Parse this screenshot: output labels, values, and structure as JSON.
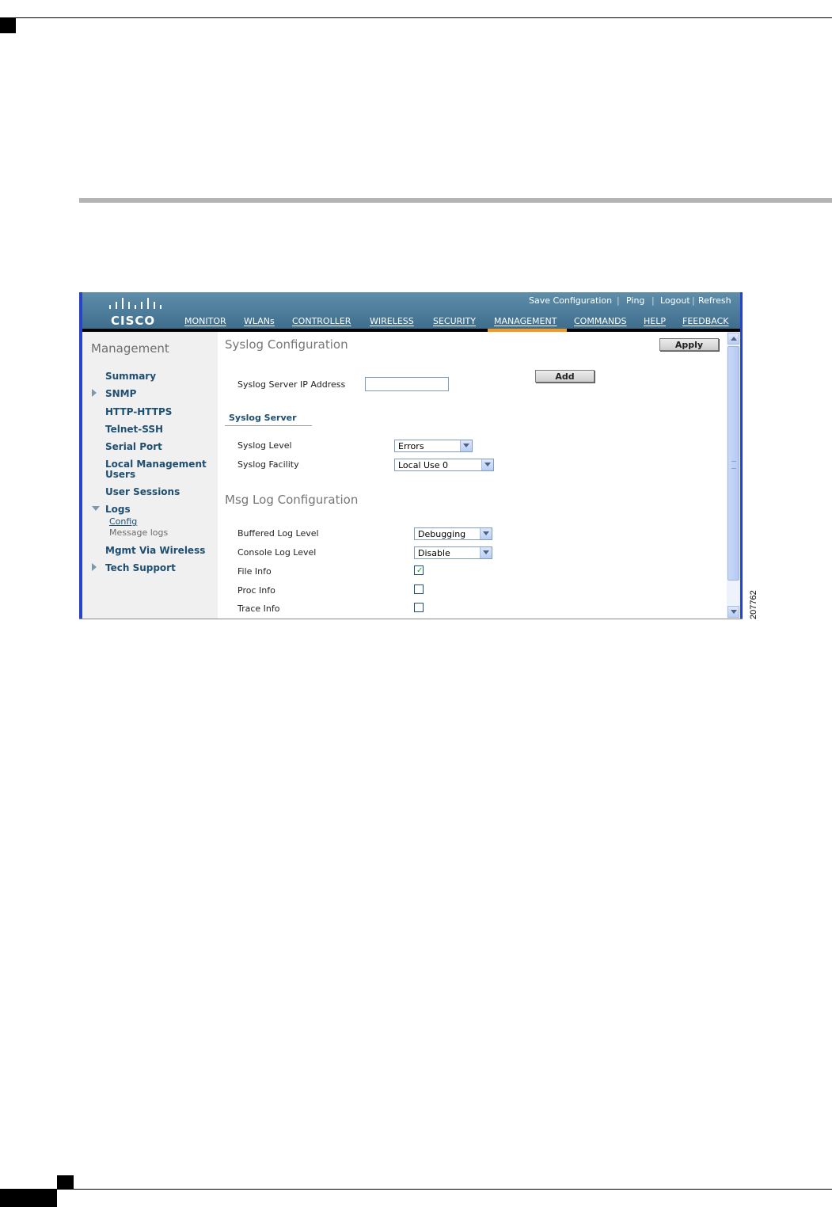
{
  "utility_links": [
    "Save Configuration",
    "Ping",
    "Logout",
    "Refresh"
  ],
  "logo_text": "CISCO",
  "nav": [
    "MONITOR",
    "WLANs",
    "CONTROLLER",
    "WIRELESS",
    "SECURITY",
    "MANAGEMENT",
    "COMMANDS",
    "HELP",
    "FEEDBACK"
  ],
  "nav_active": "MANAGEMENT",
  "sidebar": {
    "title": "Management",
    "items": [
      "Summary",
      "SNMP",
      "HTTP-HTTPS",
      "Telnet-SSH",
      "Serial Port",
      "Local Management",
      "Users",
      "User Sessions",
      "Logs",
      "Mgmt Via Wireless",
      "Tech Support"
    ],
    "sub_items": [
      "Config",
      "Message logs"
    ]
  },
  "content": {
    "title": "Syslog Configuration",
    "apply_label": "Apply",
    "server_ip_label": "Syslog Server IP Address",
    "server_ip_value": "",
    "add_label": "Add",
    "syslog_server_tab": "Syslog Server",
    "syslog_level_label": "Syslog Level",
    "syslog_level_value": "Errors",
    "syslog_facility_label": "Syslog Facility",
    "syslog_facility_value": "Local Use 0",
    "msg_log_title": "Msg Log Configuration",
    "buffered_label": "Buffered Log Level",
    "buffered_value": "Debugging",
    "console_label": "Console Log Level",
    "console_value": "Disable",
    "file_info_label": "File Info",
    "file_info_checked": true,
    "proc_info_label": "Proc Info",
    "proc_info_checked": false,
    "trace_info_label": "Trace Info",
    "trace_info_checked": false
  },
  "figure_id": "207762",
  "colors": {
    "header_top": "#5f8eab",
    "header_bottom": "#3e6e8c",
    "nav_active_underline": "#f39a1f",
    "frame_border": "#2743c9",
    "sidebar_bg": "#f0f0f0",
    "link_text": "#1e4f72",
    "checkmark": "#21a121"
  },
  "icons": [
    "cisco-logo-icon",
    "arrow-right-icon",
    "arrow-down-icon",
    "dropdown-arrow-icon",
    "checkmark-icon",
    "scroll-up-icon",
    "scroll-down-icon"
  ]
}
